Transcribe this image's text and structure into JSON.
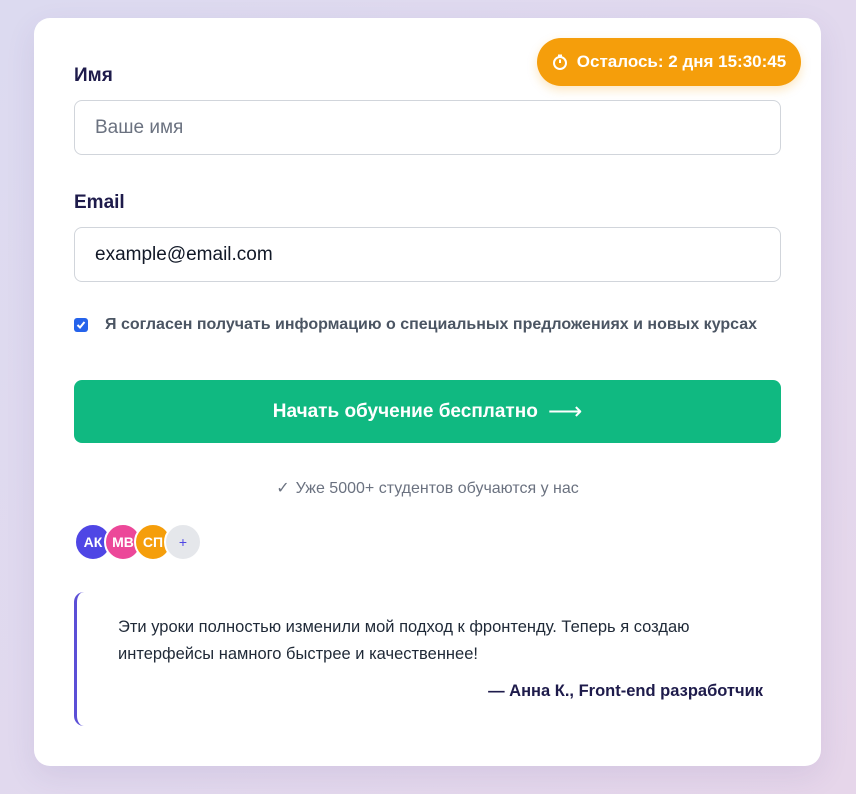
{
  "timer": {
    "icon": "stopwatch-icon",
    "text": "Осталось: 2 дня 15:30:45",
    "color": "#f59e0b"
  },
  "form": {
    "name": {
      "label": "Имя",
      "placeholder": "Ваше имя",
      "value": ""
    },
    "email": {
      "label": "Email",
      "placeholder": "",
      "value": "example@email.com"
    },
    "consent": {
      "checked": true,
      "label": "Я согласен получать информацию о специальных предложениях и новых курсах"
    },
    "submit": {
      "label": "Начать обучение бесплатно",
      "arrow": "⟶",
      "color": "#10b981"
    }
  },
  "social_proof": {
    "check": "✓",
    "text": "Уже 5000+ студентов обучаются у нас",
    "avatars": [
      {
        "initials": "АК",
        "color": "#4f46e5"
      },
      {
        "initials": "МВ",
        "color": "#ec4899"
      },
      {
        "initials": "СП",
        "color": "#f59e0b"
      },
      {
        "initials": "+",
        "color": "#e5e7eb"
      }
    ]
  },
  "testimonial": {
    "quote": "Эти уроки полностью изменили мой подход к фронтенду. Теперь я создаю интерфейсы намного быстрее и качественнее!",
    "author": "— Анна К., Front-end разработчик",
    "accent": "#5b4fd6"
  }
}
